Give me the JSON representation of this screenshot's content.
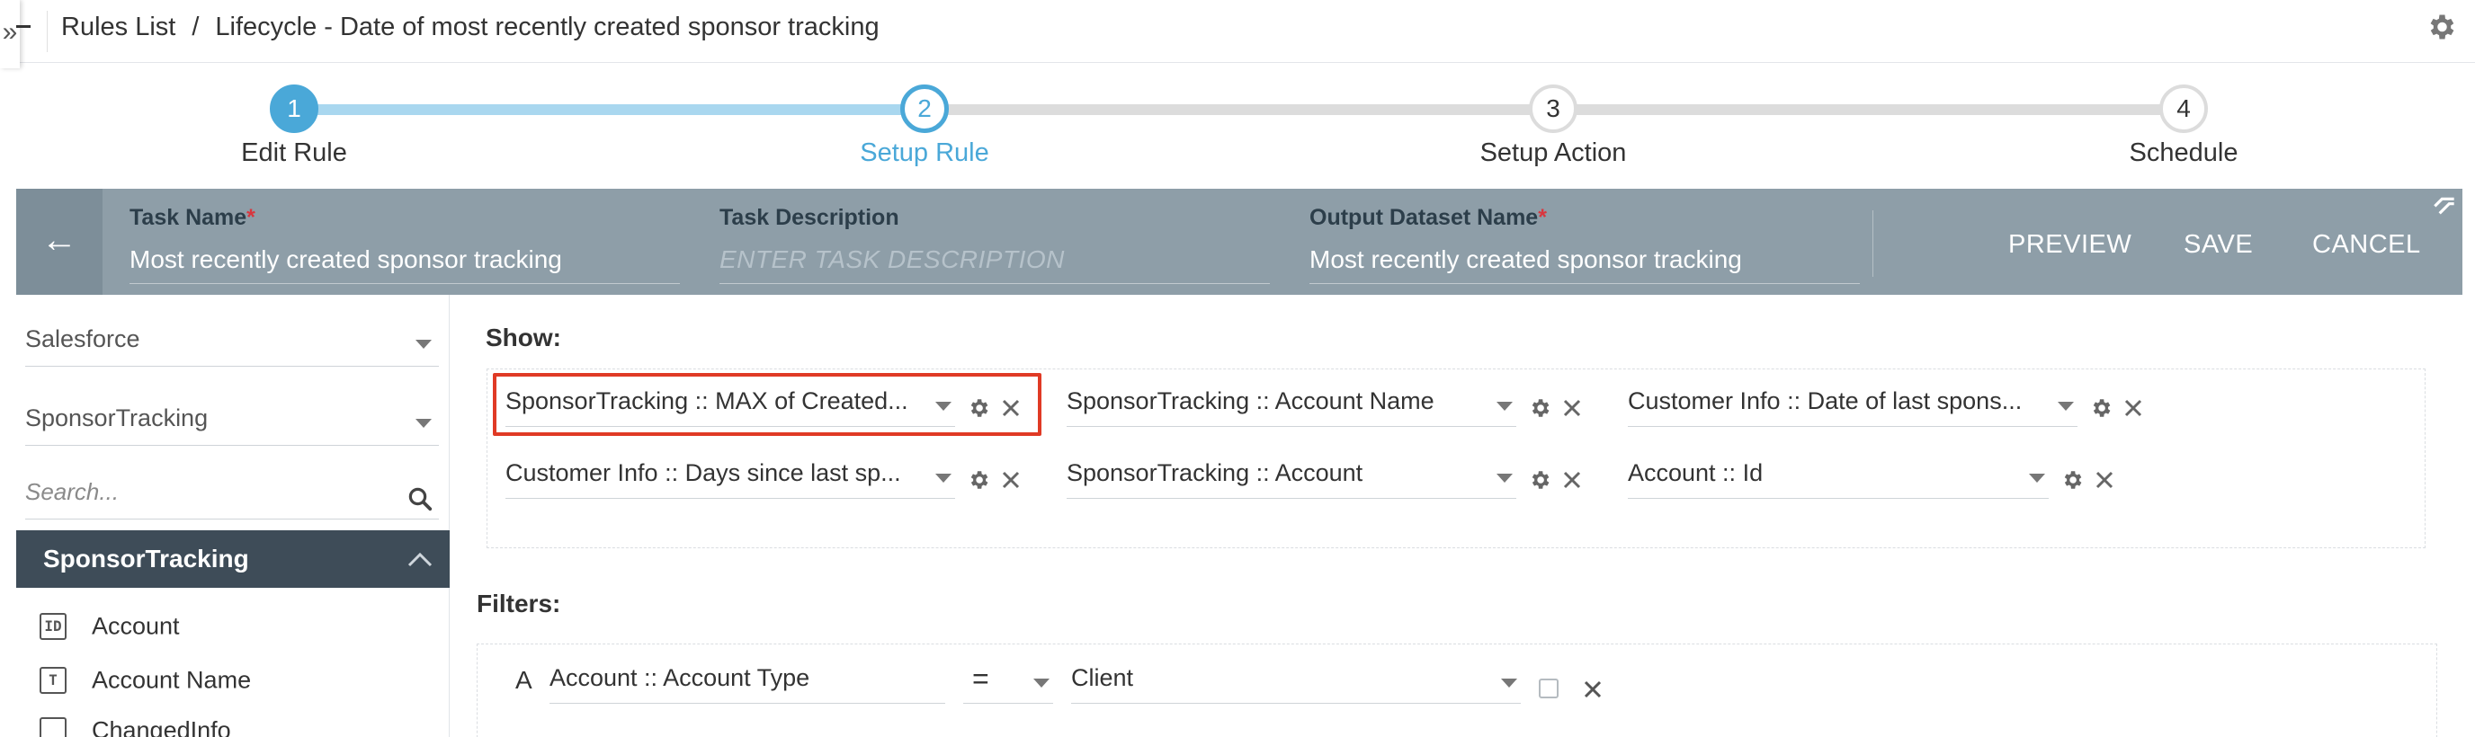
{
  "breadcrumb": {
    "root": "Rules List",
    "separator": "/",
    "current": "Lifecycle - Date of most recently created sponsor tracking"
  },
  "stepper": {
    "steps": [
      {
        "number": "1",
        "label": "Edit Rule",
        "state": "completed"
      },
      {
        "number": "2",
        "label": "Setup Rule",
        "state": "active"
      },
      {
        "number": "3",
        "label": "Setup Action",
        "state": "pending"
      },
      {
        "number": "4",
        "label": "Schedule",
        "state": "pending"
      }
    ]
  },
  "task": {
    "name_label": "Task Name",
    "name_value": "Most recently created sponsor tracking",
    "description_label": "Task Description",
    "description_placeholder": "ENTER TASK DESCRIPTION",
    "output_label": "Output Dataset Name",
    "output_value": "Most recently created sponsor tracking",
    "required_mark": "*",
    "buttons": {
      "preview": "PREVIEW",
      "save": "SAVE",
      "cancel": "CANCEL"
    }
  },
  "left_panel": {
    "source_select": "Salesforce",
    "object_select": "SponsorTracking",
    "search_placeholder": "Search...",
    "group_title": "SponsorTracking",
    "items": [
      {
        "icon": "ID",
        "label": "Account"
      },
      {
        "icon": "T",
        "label": "Account Name"
      },
      {
        "icon": "",
        "label": "ChangedInfo"
      }
    ]
  },
  "show": {
    "title": "Show:",
    "fields": [
      "SponsorTracking :: MAX of Created...",
      "SponsorTracking :: Account Name",
      "Customer Info :: Date of last spons...",
      "Customer Info :: Days since last sp...",
      "SponsorTracking :: Account",
      "Account :: Id"
    ]
  },
  "filters": {
    "title": "Filters:",
    "rows": [
      {
        "letter": "A",
        "field": "Account :: Account Type",
        "operator": "=",
        "value": "Client"
      }
    ]
  },
  "colors": {
    "accent_blue": "#4aa8d8",
    "progress_light": "#a9d7ef",
    "header_band": "#8e9ea8",
    "group_header": "#3e4c58",
    "highlight_red": "#e03a25",
    "required_red": "#d9363e"
  }
}
